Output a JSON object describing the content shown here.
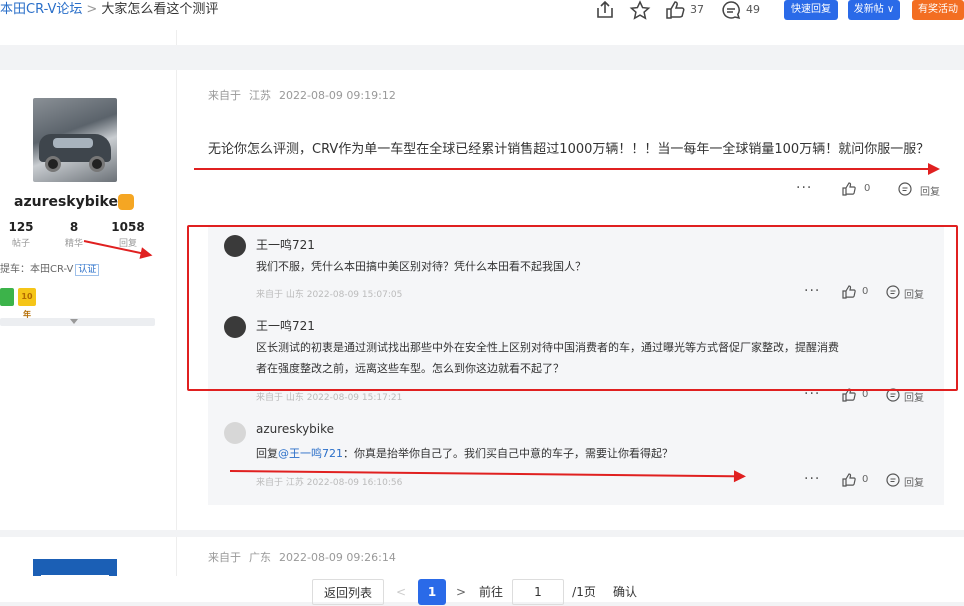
{
  "breadcrumb": {
    "forum": "本田CR-V论坛",
    "separator": ">",
    "current": "大家怎么看这个测评"
  },
  "toolbar": {
    "like_count": "37",
    "comment_count": "49",
    "quick_reply": "快速回复",
    "new_post": "发新帖",
    "event": "有奖活动"
  },
  "upper_card": {},
  "post": {
    "location_label": "来自于",
    "location": "江苏",
    "time": "2022-08-09 09:19:12",
    "text": "无论你怎么评测，CRV作为单一车型在全球已经累计销售超过1000万辆！！！当一每年一全球销量100万辆！就问你服一服？",
    "more": "···",
    "likes": "0",
    "reply_label": "回复"
  },
  "author": {
    "name": "azureskybike",
    "stats": [
      {
        "value": "125",
        "label": "帖子"
      },
      {
        "value": "8",
        "label": "精华"
      },
      {
        "value": "1058",
        "label": "回复"
      }
    ],
    "car_prefix": "提车：本田CR-V",
    "verify": "认证",
    "medal2": "10年"
  },
  "replies": [
    {
      "name": "王一鸣721",
      "text": "我们不服，凭什么本田搞中美区别对待？凭什么本田看不起我国人？",
      "meta": "来自于 山东 2022-08-09 15:07:05",
      "likes": "0",
      "reply_label": "回复"
    },
    {
      "name": "王一鸣721",
      "text_line1": "区长测试的初衷是通过测试找出那些中外在安全性上区别对待中国消费者的车，通过曝光等方式督促厂家整改，提醒消费",
      "text_line2": "者在强度整改之前，远离这些车型。怎么到你这边就看不起了？",
      "meta": "来自于 山东 2022-08-09 15:17:21",
      "likes": "0",
      "reply_label": "回复"
    },
    {
      "name": "azureskybike",
      "reply_prefix": "回复",
      "at": "@王一鸣721",
      "text": "：你真是抬举你自己了。我们买自己中意的车子，需要让你看得起？",
      "meta": "来自于 江苏 2022-08-09 16:10:56",
      "likes": "0",
      "reply_label": "回复"
    }
  ],
  "next_post": {
    "location_label": "来自于",
    "location": "广东",
    "time": "2022-08-09 09:26:14"
  },
  "pager": {
    "back": "返回列表",
    "prev": "<",
    "current": "1",
    "next": ">",
    "goto": "前往",
    "input_value": "1",
    "total": "/1页",
    "confirm": "确认"
  },
  "colors": {
    "accent": "#2a6ae8",
    "event": "#f36e22",
    "annotation_red": "#e02020"
  }
}
